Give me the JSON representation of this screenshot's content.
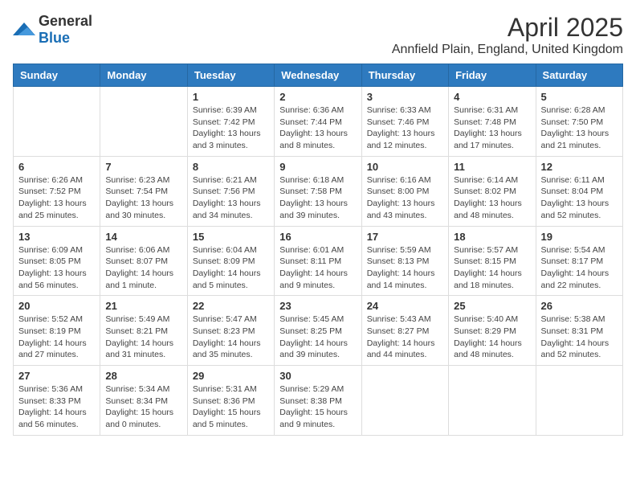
{
  "logo": {
    "general": "General",
    "blue": "Blue"
  },
  "title": "April 2025",
  "location": "Annfield Plain, England, United Kingdom",
  "days_of_week": [
    "Sunday",
    "Monday",
    "Tuesday",
    "Wednesday",
    "Thursday",
    "Friday",
    "Saturday"
  ],
  "weeks": [
    [
      null,
      null,
      {
        "day": "1",
        "sunrise": "6:39 AM",
        "sunset": "7:42 PM",
        "daylight": "13 hours and 3 minutes."
      },
      {
        "day": "2",
        "sunrise": "6:36 AM",
        "sunset": "7:44 PM",
        "daylight": "13 hours and 8 minutes."
      },
      {
        "day": "3",
        "sunrise": "6:33 AM",
        "sunset": "7:46 PM",
        "daylight": "13 hours and 12 minutes."
      },
      {
        "day": "4",
        "sunrise": "6:31 AM",
        "sunset": "7:48 PM",
        "daylight": "13 hours and 17 minutes."
      },
      {
        "day": "5",
        "sunrise": "6:28 AM",
        "sunset": "7:50 PM",
        "daylight": "13 hours and 21 minutes."
      }
    ],
    [
      {
        "day": "6",
        "sunrise": "6:26 AM",
        "sunset": "7:52 PM",
        "daylight": "13 hours and 25 minutes."
      },
      {
        "day": "7",
        "sunrise": "6:23 AM",
        "sunset": "7:54 PM",
        "daylight": "13 hours and 30 minutes."
      },
      {
        "day": "8",
        "sunrise": "6:21 AM",
        "sunset": "7:56 PM",
        "daylight": "13 hours and 34 minutes."
      },
      {
        "day": "9",
        "sunrise": "6:18 AM",
        "sunset": "7:58 PM",
        "daylight": "13 hours and 39 minutes."
      },
      {
        "day": "10",
        "sunrise": "6:16 AM",
        "sunset": "8:00 PM",
        "daylight": "13 hours and 43 minutes."
      },
      {
        "day": "11",
        "sunrise": "6:14 AM",
        "sunset": "8:02 PM",
        "daylight": "13 hours and 48 minutes."
      },
      {
        "day": "12",
        "sunrise": "6:11 AM",
        "sunset": "8:04 PM",
        "daylight": "13 hours and 52 minutes."
      }
    ],
    [
      {
        "day": "13",
        "sunrise": "6:09 AM",
        "sunset": "8:05 PM",
        "daylight": "13 hours and 56 minutes."
      },
      {
        "day": "14",
        "sunrise": "6:06 AM",
        "sunset": "8:07 PM",
        "daylight": "14 hours and 1 minute."
      },
      {
        "day": "15",
        "sunrise": "6:04 AM",
        "sunset": "8:09 PM",
        "daylight": "14 hours and 5 minutes."
      },
      {
        "day": "16",
        "sunrise": "6:01 AM",
        "sunset": "8:11 PM",
        "daylight": "14 hours and 9 minutes."
      },
      {
        "day": "17",
        "sunrise": "5:59 AM",
        "sunset": "8:13 PM",
        "daylight": "14 hours and 14 minutes."
      },
      {
        "day": "18",
        "sunrise": "5:57 AM",
        "sunset": "8:15 PM",
        "daylight": "14 hours and 18 minutes."
      },
      {
        "day": "19",
        "sunrise": "5:54 AM",
        "sunset": "8:17 PM",
        "daylight": "14 hours and 22 minutes."
      }
    ],
    [
      {
        "day": "20",
        "sunrise": "5:52 AM",
        "sunset": "8:19 PM",
        "daylight": "14 hours and 27 minutes."
      },
      {
        "day": "21",
        "sunrise": "5:49 AM",
        "sunset": "8:21 PM",
        "daylight": "14 hours and 31 minutes."
      },
      {
        "day": "22",
        "sunrise": "5:47 AM",
        "sunset": "8:23 PM",
        "daylight": "14 hours and 35 minutes."
      },
      {
        "day": "23",
        "sunrise": "5:45 AM",
        "sunset": "8:25 PM",
        "daylight": "14 hours and 39 minutes."
      },
      {
        "day": "24",
        "sunrise": "5:43 AM",
        "sunset": "8:27 PM",
        "daylight": "14 hours and 44 minutes."
      },
      {
        "day": "25",
        "sunrise": "5:40 AM",
        "sunset": "8:29 PM",
        "daylight": "14 hours and 48 minutes."
      },
      {
        "day": "26",
        "sunrise": "5:38 AM",
        "sunset": "8:31 PM",
        "daylight": "14 hours and 52 minutes."
      }
    ],
    [
      {
        "day": "27",
        "sunrise": "5:36 AM",
        "sunset": "8:33 PM",
        "daylight": "14 hours and 56 minutes."
      },
      {
        "day": "28",
        "sunrise": "5:34 AM",
        "sunset": "8:34 PM",
        "daylight": "15 hours and 0 minutes."
      },
      {
        "day": "29",
        "sunrise": "5:31 AM",
        "sunset": "8:36 PM",
        "daylight": "15 hours and 5 minutes."
      },
      {
        "day": "30",
        "sunrise": "5:29 AM",
        "sunset": "8:38 PM",
        "daylight": "15 hours and 9 minutes."
      },
      null,
      null,
      null
    ]
  ]
}
